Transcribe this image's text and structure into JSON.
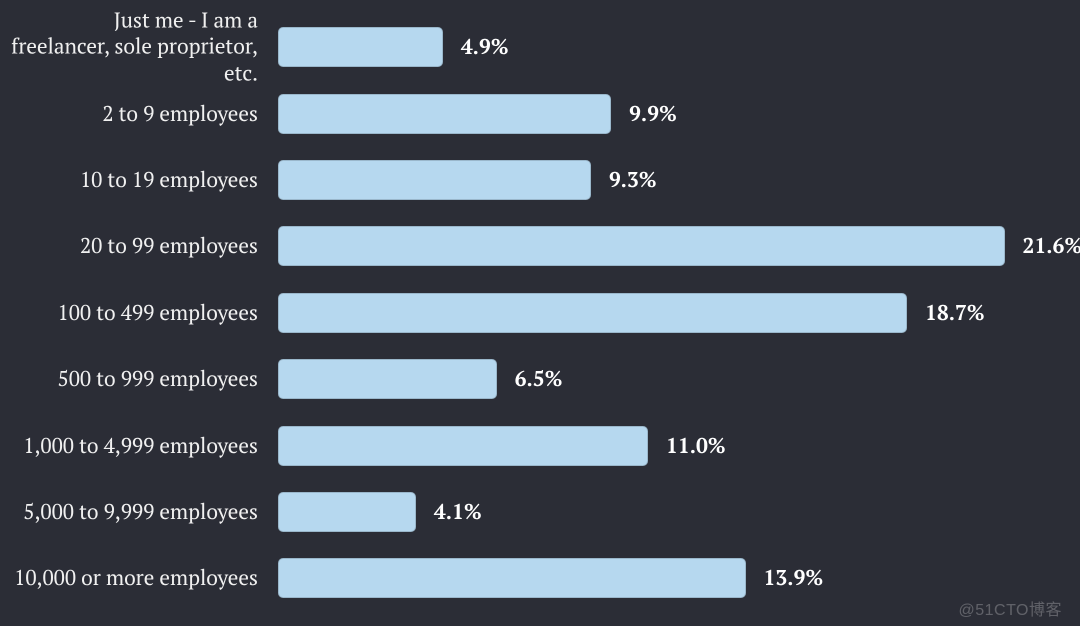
{
  "chart_data": {
    "type": "bar",
    "orientation": "horizontal",
    "title": "",
    "xlabel": "",
    "ylabel": "",
    "value_suffix": "%",
    "xlim": [
      0,
      22
    ],
    "categories": [
      "Just me - I am a freelancer, sole proprietor, etc.",
      "2 to 9 employees",
      "10 to 19 employees",
      "20 to 99 employees",
      "100 to 499 employees",
      "500 to 999 employees",
      "1,000 to 4,999 employees",
      "5,000 to 9,999 employees",
      "10,000 or more employees"
    ],
    "values": [
      4.9,
      9.9,
      9.3,
      21.6,
      18.7,
      6.5,
      11.0,
      4.1,
      13.9
    ],
    "value_labels": [
      "4.9%",
      "9.9%",
      "9.3%",
      "21.6%",
      "18.7%",
      "6.5%",
      "11.0%",
      "4.1%",
      "13.9%"
    ],
    "bar_color": "#b6d8ef",
    "text_color": "#ffffff",
    "bg_color": "#2b2d36"
  },
  "watermark": "@51CTO博客"
}
